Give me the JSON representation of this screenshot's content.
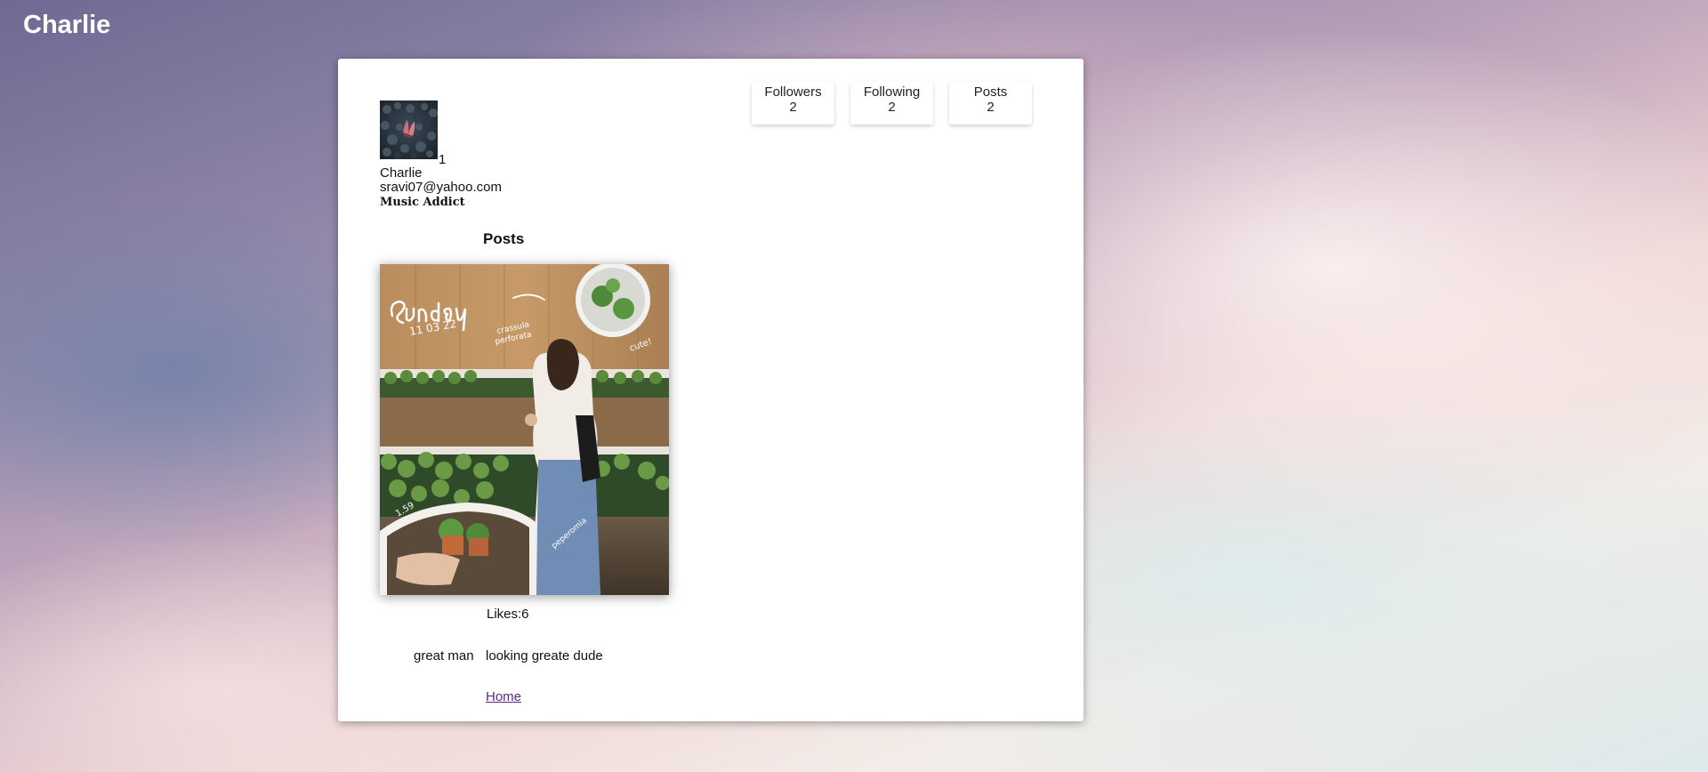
{
  "header": {
    "title": "Charlie"
  },
  "stats": [
    {
      "label": "Followers",
      "value": "2"
    },
    {
      "label": "Following",
      "value": "2"
    },
    {
      "label": "Posts",
      "value": "2"
    }
  ],
  "profile": {
    "avatar_count": "1",
    "name": "Charlie",
    "email": "sravi07@yahoo.com",
    "bio": "Music Addict"
  },
  "posts": {
    "heading": "Posts",
    "items": [
      {
        "likes": "Likes:6",
        "comment_user": "great man",
        "comment_text": "looking greate dude"
      }
    ]
  },
  "footer": {
    "home_link": "Home"
  },
  "colors": {
    "link": "#5b2a86",
    "card": "#ffffff",
    "title_text": "#ffffff"
  }
}
